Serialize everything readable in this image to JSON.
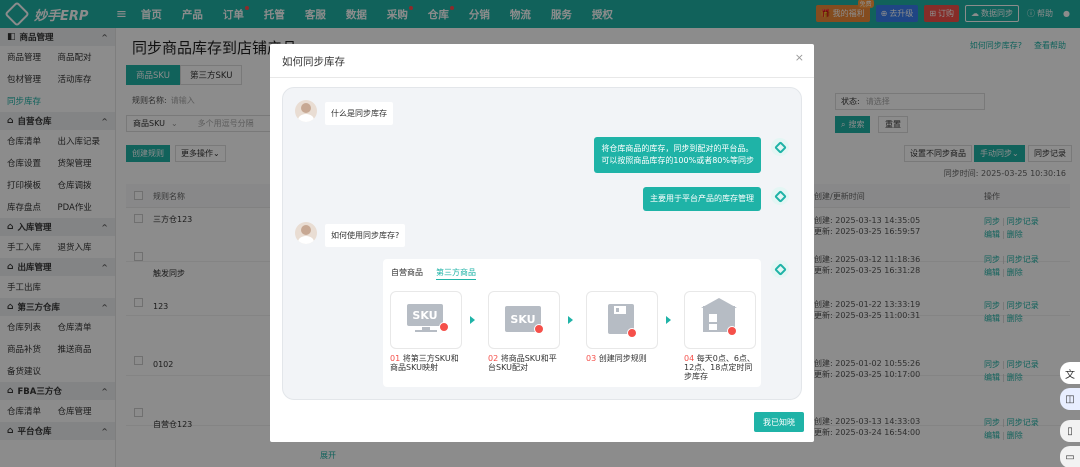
{
  "logo": "妙手ERP",
  "nav": [
    {
      "label": "首页",
      "dot": false
    },
    {
      "label": "产品",
      "dot": false
    },
    {
      "label": "订单",
      "dot": true
    },
    {
      "label": "托管",
      "dot": false
    },
    {
      "label": "客服",
      "dot": false
    },
    {
      "label": "数据",
      "dot": false
    },
    {
      "label": "采购",
      "dot": true
    },
    {
      "label": "仓库",
      "dot": true
    },
    {
      "label": "分销",
      "dot": false
    },
    {
      "label": "物流",
      "dot": false
    },
    {
      "label": "服务",
      "dot": false
    },
    {
      "label": "授权",
      "dot": false
    }
  ],
  "top_right": {
    "my_benefits": "我的福利",
    "my_benefits_badge": "免费",
    "upgrade": "去升级",
    "order": "订购",
    "data_sync": "数据同步",
    "help": "帮助"
  },
  "sidebar": [
    {
      "title": "商品管理",
      "items": [
        "商品管理",
        "商品配对",
        "包材管理",
        "活动库存",
        "同步库存"
      ]
    },
    {
      "title": "自营仓库",
      "items": [
        "仓库清单",
        "出入库记录",
        "仓库设置",
        "货架管理",
        "打印模板",
        "仓库调拨",
        "库存盘点",
        "PDA作业"
      ]
    },
    {
      "title": "入库管理",
      "items": [
        "手工入库",
        "退货入库"
      ]
    },
    {
      "title": "出库管理",
      "items": [
        "手工出库"
      ]
    },
    {
      "title": "第三方仓库",
      "items": [
        "仓库列表",
        "仓库清单",
        "商品补货",
        "推送商品",
        "备货建议"
      ]
    },
    {
      "title": "FBA三方仓",
      "items": [
        "仓库清单",
        "仓库管理"
      ]
    },
    {
      "title": "平台仓库",
      "items": []
    }
  ],
  "sidebar_active": "同步库存",
  "page": {
    "title": "同步商品库存到店铺产品",
    "help_links": [
      "如何同步库存?",
      "查看帮助"
    ],
    "tabs": [
      "商品SKU",
      "第三方SKU"
    ],
    "rule_name_label": "规则名称:",
    "rule_name_placeholder": "请输入",
    "sku_select": "商品SKU",
    "sku_placeholder": "多个用逗号分隔",
    "state_label": "状态:",
    "state_placeholder": "请选择",
    "search_btn": "搜索",
    "reset_btn": "重置",
    "create_btn": "创建规则",
    "more_ops": "更多操作",
    "set_no_sync": "设置不同步商品",
    "manual_sync": "手动同步",
    "sync_record": "同步记录",
    "sync_time_label": "同步时间:",
    "sync_time": "2025-03-25 10:30:16",
    "col_rule_name": "规则名称",
    "col_time": "创建/更新时间",
    "col_ops": "操作",
    "rows": [
      {
        "name": "三方仓123",
        "created": "创建: 2025-03-13 14:35:05",
        "updated": "更新: 2025-03-25 16:59:57"
      },
      {
        "name": "触发同步",
        "created": "创建: 2025-03-12 11:18:36",
        "updated": "更新: 2025-03-25 16:31:28"
      },
      {
        "name": "123",
        "created": "创建: 2025-01-22 13:33:19",
        "updated": "更新: 2025-03-25 11:00:31"
      },
      {
        "name": "0102",
        "created": "创建: 2025-01-02 10:55:26",
        "updated": "更新: 2025-03-25 10:17:00"
      },
      {
        "name": "自营仓123",
        "created": "创建: 2025-03-13 14:33:03",
        "updated": "更新: 2025-03-24 16:54:00"
      }
    ],
    "op_sync": "同步",
    "op_sync_record": "同步记录",
    "op_edit": "编辑",
    "op_delete": "删除",
    "expand": "展开"
  },
  "modal": {
    "title": "如何同步库存",
    "close": "×",
    "q1": "什么是同步库存",
    "a1_line1": "将仓库商品的库存，同步到配对的平台品。",
    "a1_line2": "可以按照商品库存的100%或者80%等同步",
    "a2": "主要用于平台产品的库存管理",
    "q2": "如何使用同步库存?",
    "flow_tabs": [
      "自营商品",
      "第三方商品"
    ],
    "steps": [
      {
        "num": "01",
        "text": "将第三方SKU和商品SKU映射"
      },
      {
        "num": "02",
        "text": "将商品SKU和平台SKU配对"
      },
      {
        "num": "03",
        "text": "创建同步规则"
      },
      {
        "num": "04",
        "text": "每天0点、6点、12点、18点定时同步库存"
      }
    ],
    "sku_icon_text": "SKU",
    "ok_btn": "我已知晓"
  },
  "icons": {
    "menu": "menu-icon",
    "bot": "bot-diamond-icon",
    "search": "search-icon"
  },
  "colors": {
    "brand": "#1fb3a7",
    "accent_red": "#f5504a",
    "orange": "#f08a3a"
  }
}
